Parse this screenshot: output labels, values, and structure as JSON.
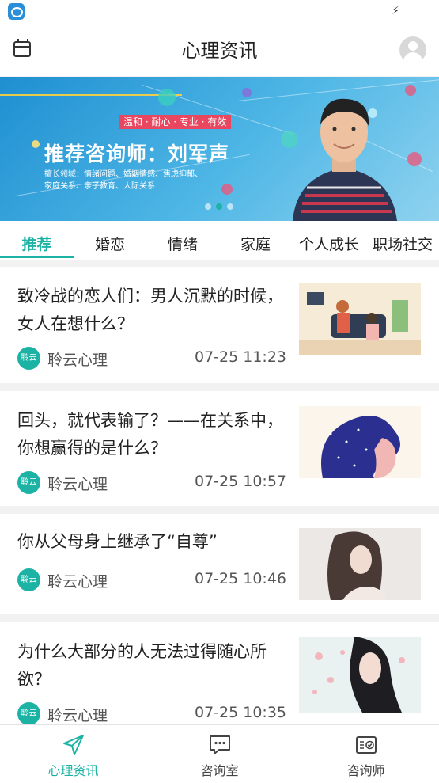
{
  "status_bar": {
    "charging_icon": "charging-bolt-icon"
  },
  "header": {
    "title": "心理资讯"
  },
  "banner": {
    "tagline": "温和 · 耐心 · 专业 · 有效",
    "headline": "推荐咨询师：刘军声",
    "expertise_line1": "擅长领域：情绪问题、婚姻情感、焦虑抑郁、",
    "expertise_line2": "家庭关系、亲子教育、人际关系",
    "accent_color": "#e8475f"
  },
  "tabs": [
    {
      "label": "推荐",
      "active": true
    },
    {
      "label": "婚恋"
    },
    {
      "label": "情绪"
    },
    {
      "label": "家庭"
    },
    {
      "label": "个人成长"
    },
    {
      "label": "职场社交"
    }
  ],
  "articles": [
    {
      "title": "致冷战的恋人们：男人沉默的时候，女人在想什么？",
      "source_badge": "聆云",
      "source": "聆云心理",
      "time": "07-25 11:23"
    },
    {
      "title": "回头，就代表输了？——在关系中，你想赢得的是什么？",
      "source_badge": "聆云",
      "source": "聆云心理",
      "time": "07-25 10:57"
    },
    {
      "title": "你从父母身上继承了“自尊”",
      "source_badge": "聆云",
      "source": "聆云心理",
      "time": "07-25 10:46"
    },
    {
      "title": "为什么大部分的人无法过得随心所欲？",
      "source_badge": "聆云",
      "source": "聆云心理",
      "time": "07-25 10:35"
    }
  ],
  "bottom_nav": [
    {
      "label": "心理资讯",
      "icon": "paper-plane-icon",
      "active": true
    },
    {
      "label": "咨询室",
      "icon": "chat-bubble-icon"
    },
    {
      "label": "咨询师",
      "icon": "id-card-check-icon"
    }
  ],
  "colors": {
    "accent": "#1cb3a4",
    "background": "#f2f2f2"
  }
}
